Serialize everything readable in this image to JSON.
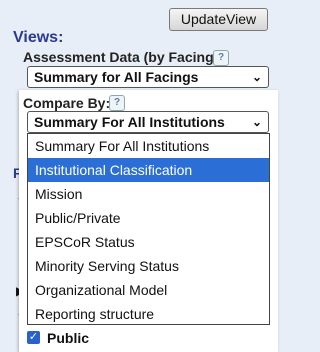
{
  "toolbar": {
    "update_label": "UpdateView"
  },
  "views": {
    "title": "Views:",
    "assessment_label": "Assessment Data (by Facing):",
    "assessment_value": "Summary for All Facings",
    "help_glyph": "?"
  },
  "compare": {
    "label": "Compare By:",
    "help_glyph": "?",
    "selected_value": "Summary For All Institutions",
    "options": [
      "Summary For All Institutions",
      "Institutional Classification",
      "Mission",
      "Public/Private",
      "EPSCoR Status",
      "Minority Serving Status",
      "Organizational Model",
      "Reporting structure"
    ],
    "highlighted_option": "Institutional Classification"
  },
  "filters": {
    "partial_letters": "Fi",
    "public_label": "Public",
    "checkbox_glyph": "✓"
  },
  "icons": {
    "chevron_down": "chevron-down-icon",
    "help": "help-icon",
    "triangle": "disclosure-triangle-icon"
  },
  "colors": {
    "highlight": "#2b6fd6",
    "heading": "#2a3a8f",
    "checkbox": "#2a62c9"
  }
}
